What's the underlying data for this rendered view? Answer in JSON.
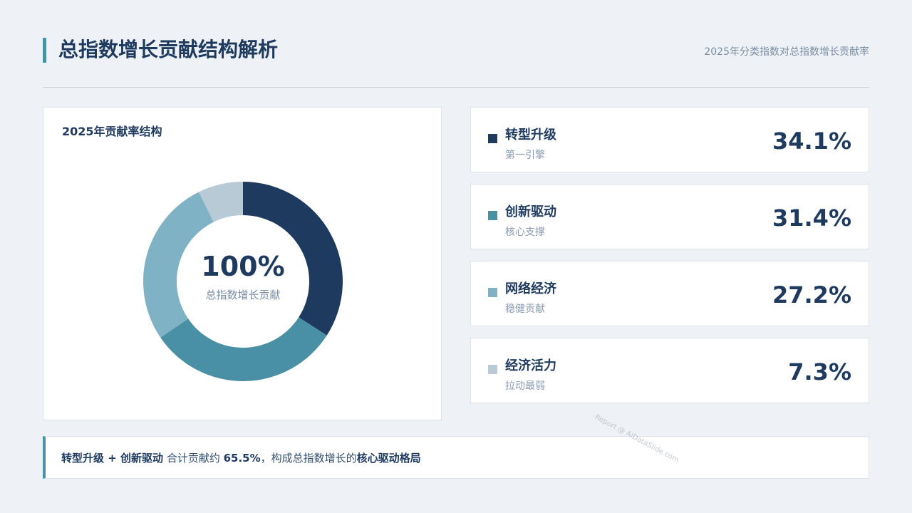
{
  "header": {
    "title": "总指数增长贡献结构解析",
    "subtitle": "2025年分类指数对总指数增长贡献率"
  },
  "chart_card": {
    "title": "2025年贡献率结构",
    "center_value": "100%",
    "center_label": "总指数增长贡献"
  },
  "chart_data": {
    "type": "pie",
    "donut": true,
    "start_angle_deg": 0,
    "direction": "clockwise",
    "categories": [
      "转型升级",
      "创新驱动",
      "网络经济",
      "经济活力"
    ],
    "values": [
      34.1,
      31.4,
      27.2,
      7.3
    ],
    "unit": "%",
    "colors": [
      "#1e3a5f",
      "#4a90a4",
      "#7fb2c4",
      "#b8cad6"
    ]
  },
  "stats": [
    {
      "name": "转型升级",
      "desc": "第一引擎",
      "value": "34.1%",
      "color": "#1e3a5f"
    },
    {
      "name": "创新驱动",
      "desc": "核心支撑",
      "value": "31.4%",
      "color": "#4a90a4"
    },
    {
      "name": "网络经济",
      "desc": "稳健贡献",
      "value": "27.2%",
      "color": "#7fb2c4"
    },
    {
      "name": "经济活力",
      "desc": "拉动最弱",
      "value": "7.3%",
      "color": "#b8cad6"
    }
  ],
  "summary": {
    "part1": "转型升级",
    "part2": " + ",
    "part3": "创新驱动",
    "part4": " 合计贡献约 ",
    "part5": "65.5%",
    "part6": "，构成总指数增长的",
    "part7": "核心驱动格局"
  },
  "watermark": "Report @ AIDataSlide.com"
}
